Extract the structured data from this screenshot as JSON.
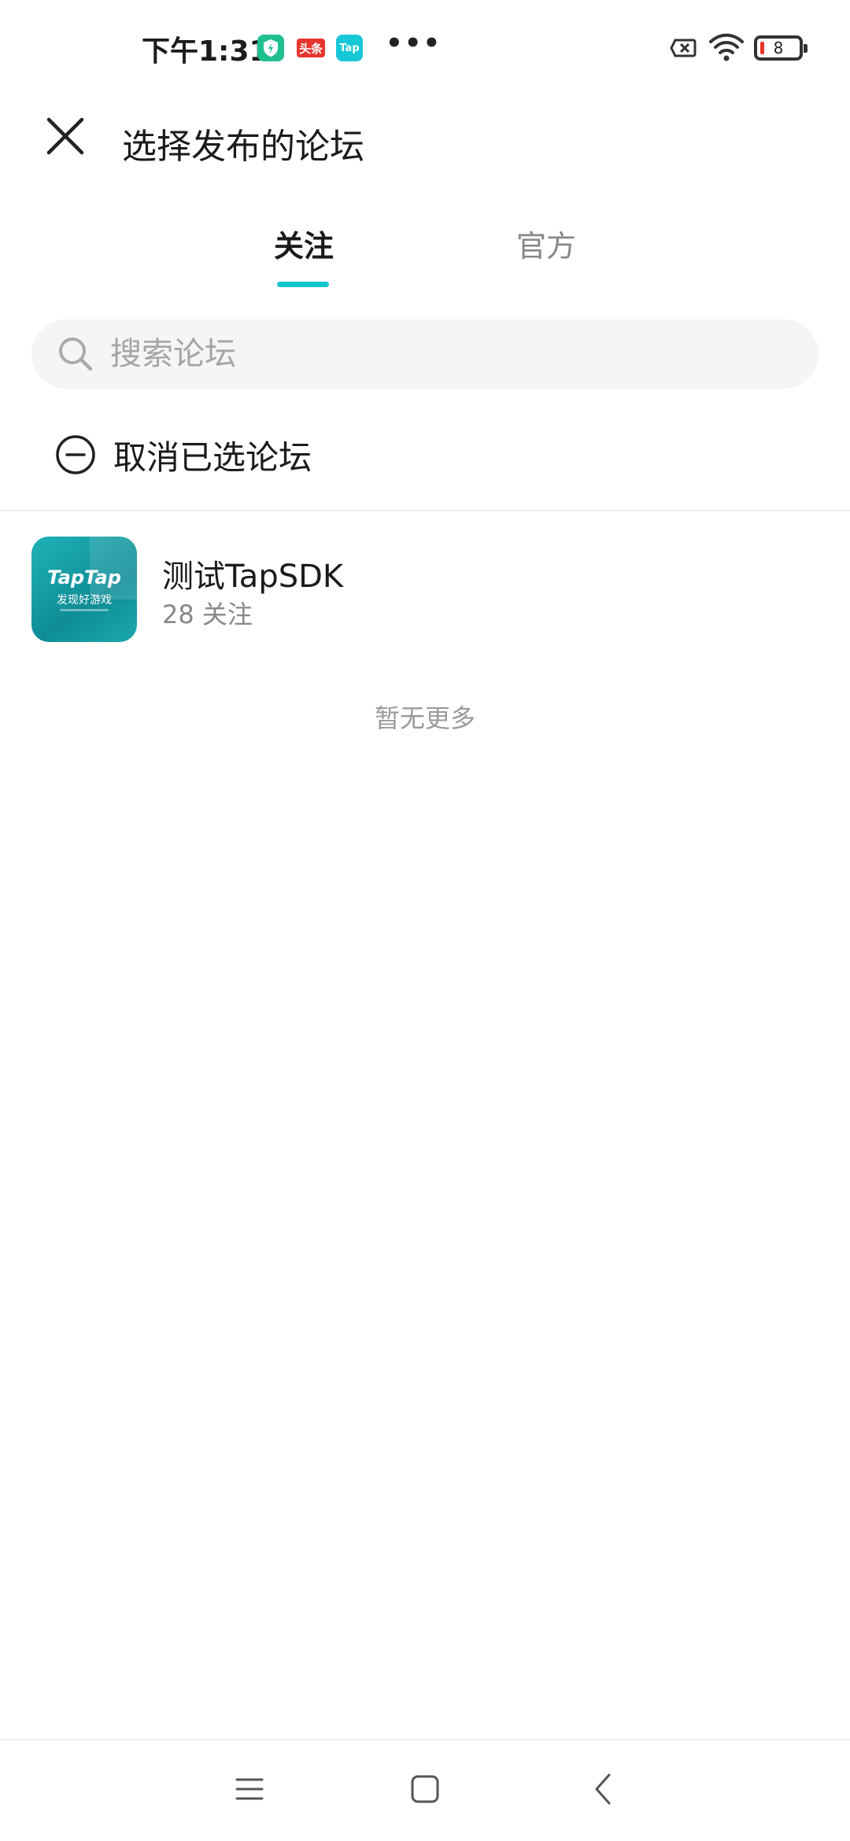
{
  "status_bar": {
    "time": "下午1:31",
    "notif_toutiao": "头条",
    "notif_tap": "Tap",
    "more": "•••",
    "battery": "8"
  },
  "header": {
    "title": "选择发布的论坛"
  },
  "tabs": [
    {
      "label": "关注"
    },
    {
      "label": "官方"
    }
  ],
  "search": {
    "placeholder": "搜索论坛",
    "value": ""
  },
  "cancel_selection": {
    "label": "取消已选论坛"
  },
  "forums": [
    {
      "name": "测试TapSDK",
      "followers": "28 关注",
      "avatar_brand": "TapTap",
      "avatar_slogan": "发现好游戏"
    }
  ],
  "list_end": "暂无更多",
  "colors": {
    "accent": "#15c5ce",
    "primary_text": "#1b1b1b",
    "secondary_text": "#888888"
  }
}
